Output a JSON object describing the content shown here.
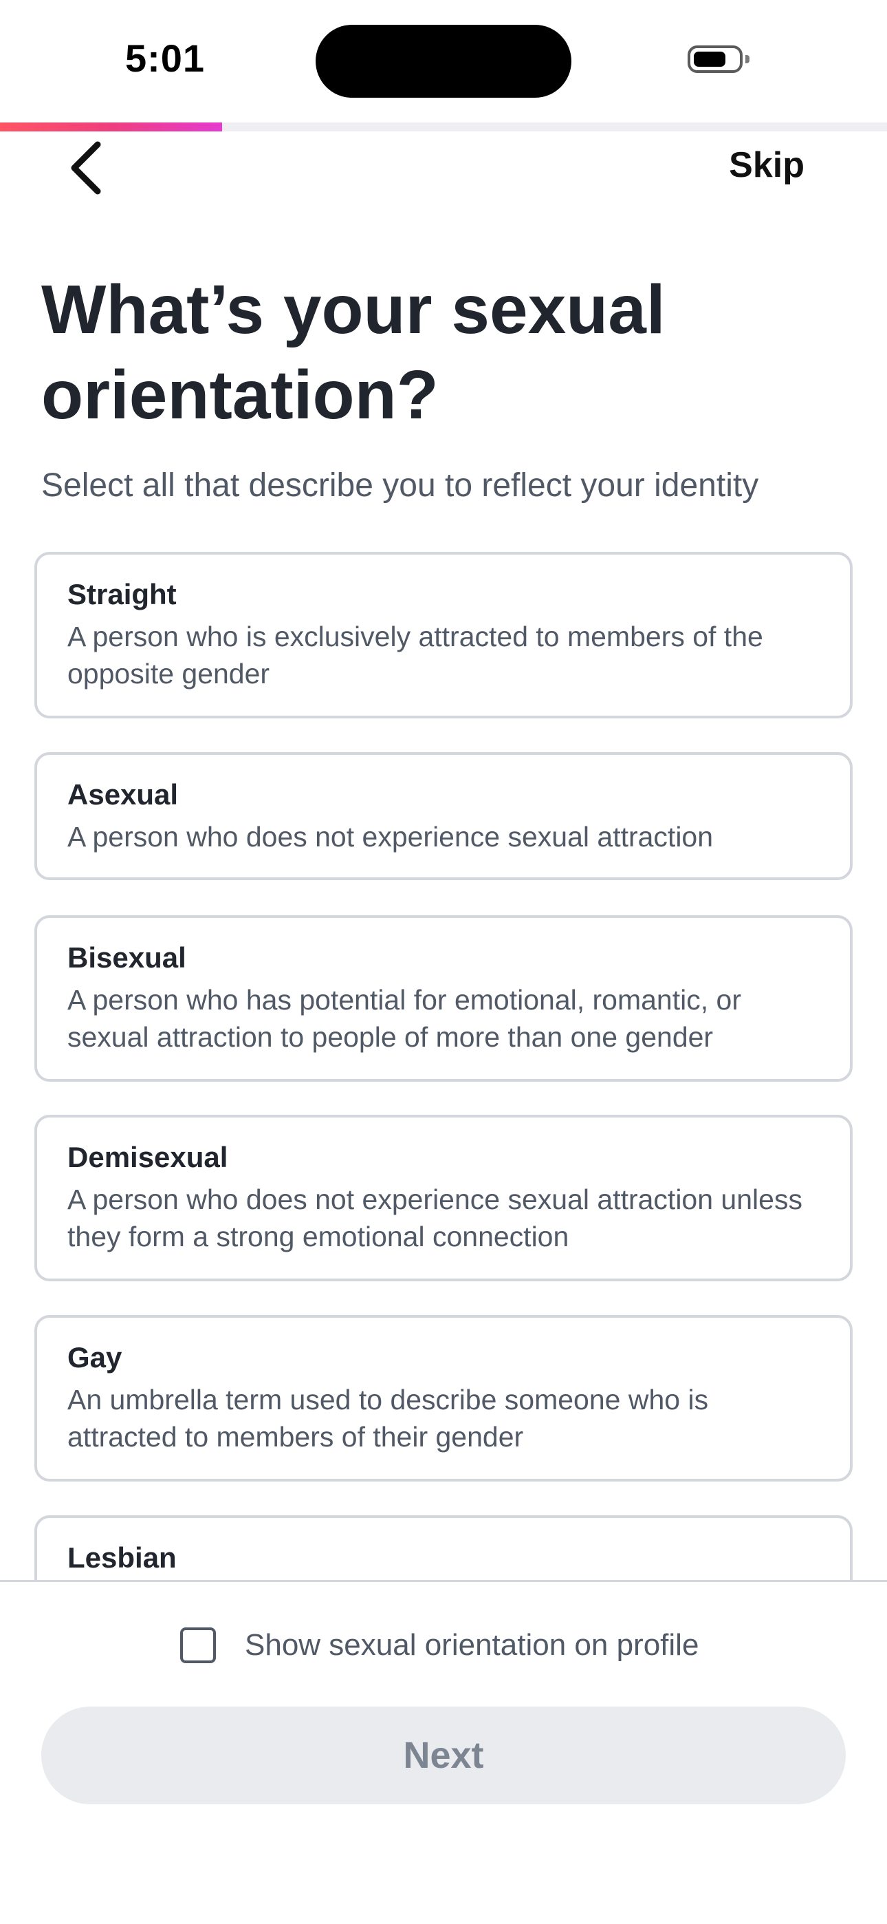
{
  "status_bar": {
    "time": "5:01",
    "icons": [
      "dynamic-island",
      "battery-icon"
    ]
  },
  "progress": {
    "percent": 25,
    "colors": [
      "#fd5564",
      "#ef3e7e",
      "#e43cd0"
    ]
  },
  "header": {
    "back_icon": "chevron-left-icon",
    "skip_label": "Skip"
  },
  "main": {
    "title": "What’s your sexual orientation?",
    "subtitle": "Select all that describe you to reflect your identity",
    "options": [
      {
        "name": "Straight",
        "description": "A person who is exclusively attracted to members of the opposite gender"
      },
      {
        "name": "Asexual",
        "description": "A person who does not experience sexual attraction"
      },
      {
        "name": "Bisexual",
        "description": "A person who has potential for emotional, romantic, or sexual attraction to people of more than one gender"
      },
      {
        "name": "Demisexual",
        "description": "A person who does not experience sexual attraction unless they form a strong emotional connection"
      },
      {
        "name": "Gay",
        "description": "An umbrella term used to describe someone who is attracted to members of their gender"
      },
      {
        "name": "Lesbian",
        "description": ""
      }
    ]
  },
  "footer": {
    "show_on_profile_label": "Show sexual orientation on profile",
    "show_on_profile_checked": false,
    "next_label": "Next",
    "next_enabled": false
  },
  "colors": {
    "accent_gradient_start": "#fd5564",
    "accent_gradient_end": "#e43cd0",
    "text_primary": "#21262e",
    "text_secondary": "#505965",
    "card_border": "#d4d6dd",
    "button_disabled_bg": "#e9ebee",
    "button_disabled_text": "#7c8591"
  }
}
